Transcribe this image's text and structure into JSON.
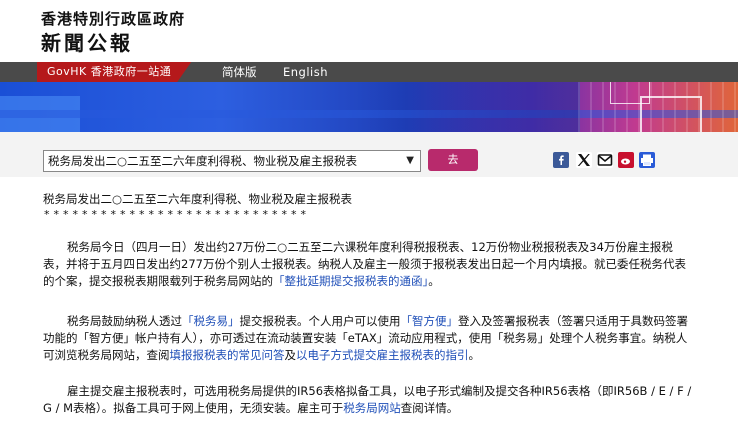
{
  "header": {
    "gov_name": "香港特別行政區政府",
    "site_title": "新聞公報"
  },
  "nav": {
    "govhk": "GovHK 香港政府一站通",
    "simplified": "简体版",
    "english": "English"
  },
  "toolbar": {
    "select_value": "税务局发出二○二五至二六年度利得税、物业税及雇主报税表",
    "go_label": "去",
    "share_icons": [
      "facebook-icon",
      "x-icon",
      "email-icon",
      "weibo-icon",
      "print-icon"
    ]
  },
  "article": {
    "title": "税务局发出二○二五至二六年度利得税、物业税及雇主报税表",
    "stars": "****************************",
    "p1": {
      "text_a": "税务局今日（四月一日）发出约27万份二○二五至二六课税年度利得税报税表、12万份物业税报税表及34万份雇主报税表，并将于五月四日发出约277万份个别人士报税表。纳税人及雇主一般须于报税表发出日起一个月内填报。就已委任税务代表的个案，提交报税表期限载列于税务局网站的",
      "link": "「整批延期提交报税表的通函」",
      "text_b": "。"
    },
    "p2": {
      "text_a": "税务局鼓励纳税人透过",
      "link1": "「税务易」",
      "text_b": "提交报税表。个人用户可以使用",
      "link2": "「智方便」",
      "text_c": "登入及签署报税表（签署只适用于具数码签署功能的「智方便」帐户持有人），亦可透过在流动装置安装「eTAX」流动应用程式，使用「税务易」处理个人税务事宜。纳税人可浏览税务局网站，查阅",
      "link3": "填报报税表的常见问答",
      "text_d": "及",
      "link4": "以电子方式提交雇主报税表的指引",
      "text_e": "。"
    },
    "p3": {
      "text_a": "雇主提交雇主报税表时，可选用税务局提供的IR56表格拟备工具，以电子形式编制及提交各种IR56表格（即IR56B / E / F / G / M表格）。拟备工具可于网上使用，无须安装。雇主可于",
      "link": "税务局网站",
      "text_b": "查阅详情。"
    }
  },
  "colors": {
    "nav_bg": "#4a4a4a",
    "govhk_red": "#b5191b",
    "go_button": "#b82a6c",
    "link": "#1f4fb8",
    "toolbar_bg": "#f3f3f3"
  }
}
